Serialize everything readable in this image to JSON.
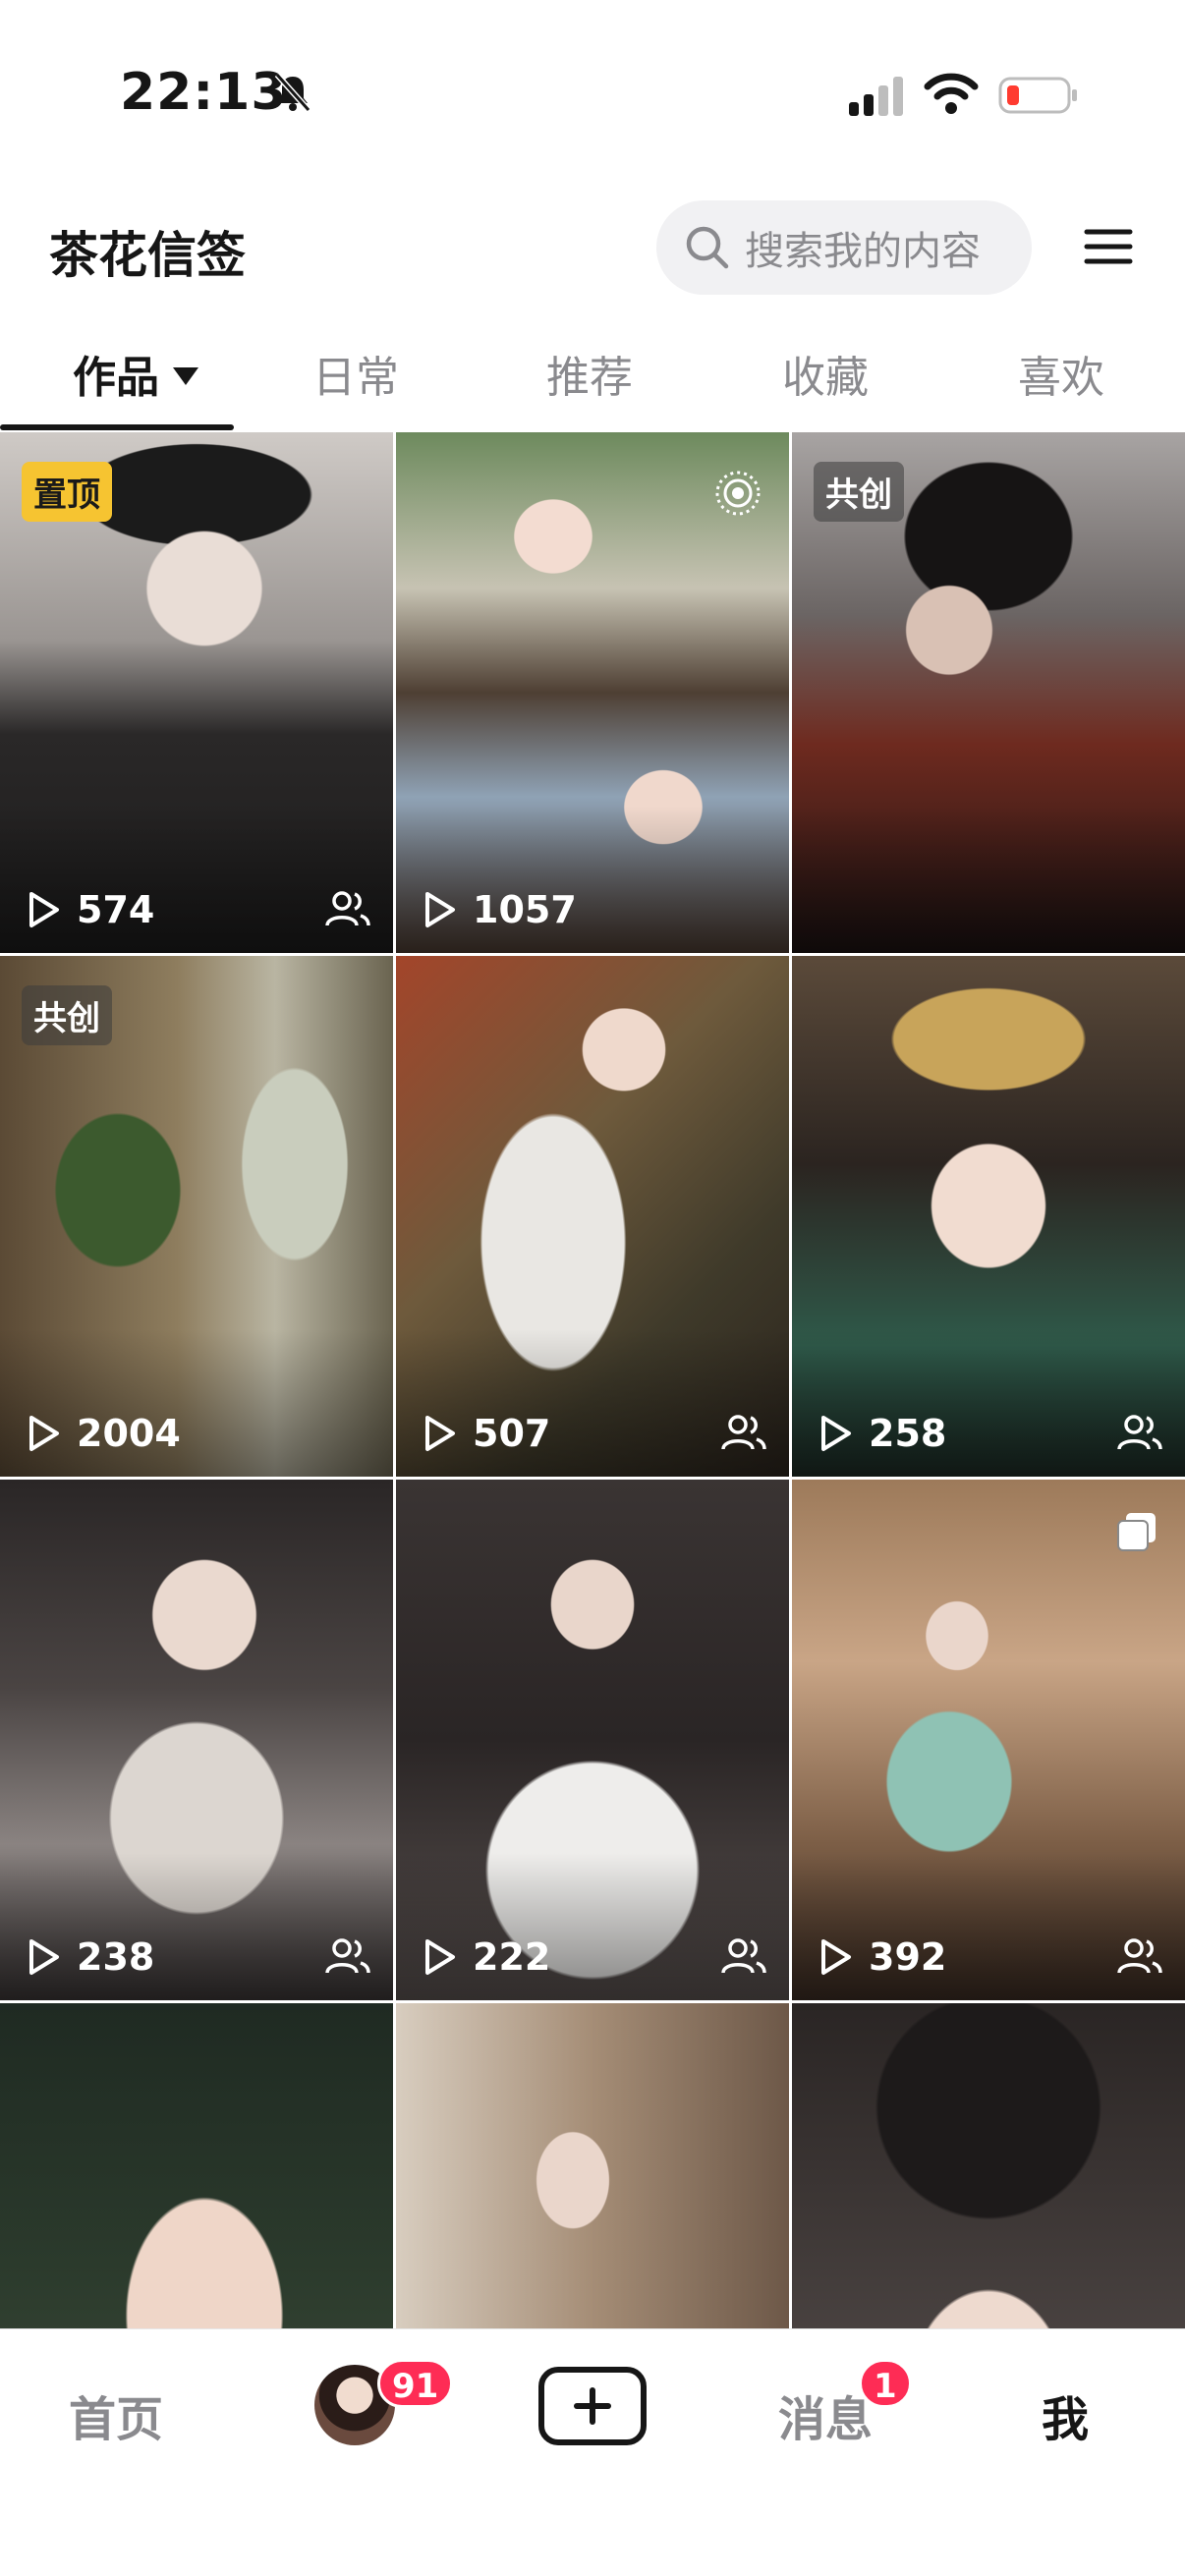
{
  "status_bar": {
    "time": "22:13"
  },
  "header": {
    "title": "茶花信签",
    "search": {
      "placeholder": "搜索我的内容"
    }
  },
  "tabs": [
    {
      "label": "作品"
    },
    {
      "label": "日常"
    },
    {
      "label": "推荐"
    },
    {
      "label": "收藏"
    },
    {
      "label": "喜欢"
    }
  ],
  "videos": [
    {
      "plays": "574",
      "badge": "置顶"
    },
    {
      "plays": "1057"
    },
    {
      "badge": "共创"
    },
    {
      "plays": "2004",
      "badge": "共创"
    },
    {
      "plays": "507"
    },
    {
      "plays": "258"
    },
    {
      "plays": "238"
    },
    {
      "plays": "222"
    },
    {
      "plays": "392"
    },
    {},
    {},
    {}
  ],
  "bottom_nav": {
    "home": "首页",
    "friends_badge": "91",
    "messages": "消息",
    "messages_badge": "1",
    "me": "我"
  },
  "colors": {
    "accent_red": "#fe2c55",
    "pin_badge": "#f6c431"
  }
}
